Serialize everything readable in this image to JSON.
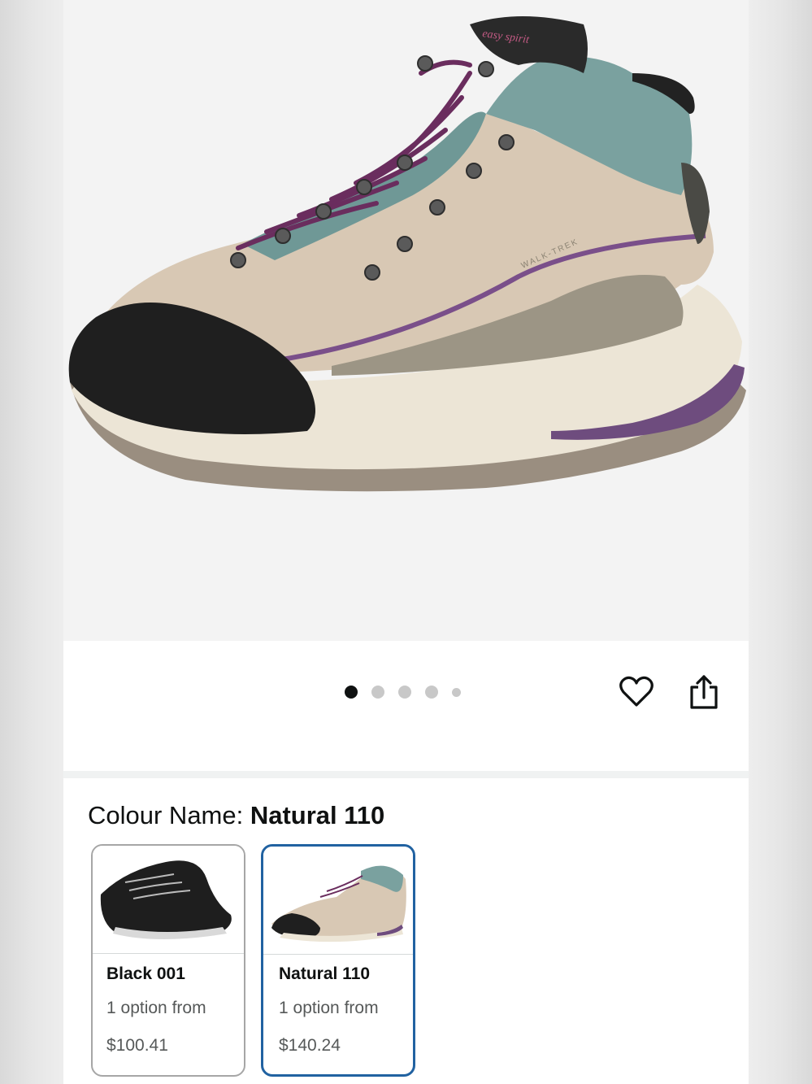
{
  "product": {
    "image_alt": "Women's hiking boot, Natural 110",
    "brand_mark": "easy spirit",
    "side_text": "WALK-TREK"
  },
  "carousel": {
    "total_images": 5,
    "active_index": 0
  },
  "actions": {
    "favourite_icon": "heart-icon",
    "share_icon": "share-icon"
  },
  "colour": {
    "label": "Colour Name: ",
    "selected": "Natural 110",
    "options": [
      {
        "name": "Black 001",
        "availability": "1 option from",
        "price": "$100.41",
        "selected": false
      },
      {
        "name": "Natural 110",
        "availability": "1 option from",
        "price": "$140.24",
        "selected": true
      }
    ]
  },
  "colors": {
    "accent_selected": "#2162a1",
    "dot_active": "#0f1111",
    "dot_inactive": "#c8c8c8"
  }
}
